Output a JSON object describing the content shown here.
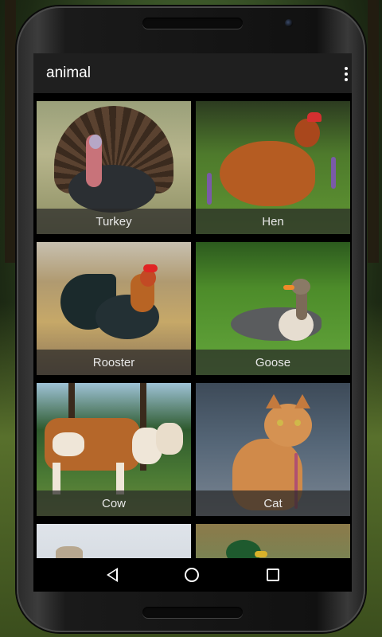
{
  "app_bar": {
    "title": "animal",
    "overflow_icon": "more-vertical-icon"
  },
  "grid": {
    "items": [
      {
        "label": "Turkey"
      },
      {
        "label": "Hen"
      },
      {
        "label": "Rooster"
      },
      {
        "label": "Goose"
      },
      {
        "label": "Cow"
      },
      {
        "label": "Cat"
      },
      {
        "label": ""
      },
      {
        "label": ""
      }
    ]
  },
  "nav_bar": {
    "back_icon": "back-triangle-icon",
    "home_icon": "home-circle-icon",
    "recents_icon": "recents-square-icon"
  },
  "colors": {
    "app_bar": "#1f1f1f",
    "caption_bg": "#282828",
    "screen_bg": "#000000"
  }
}
